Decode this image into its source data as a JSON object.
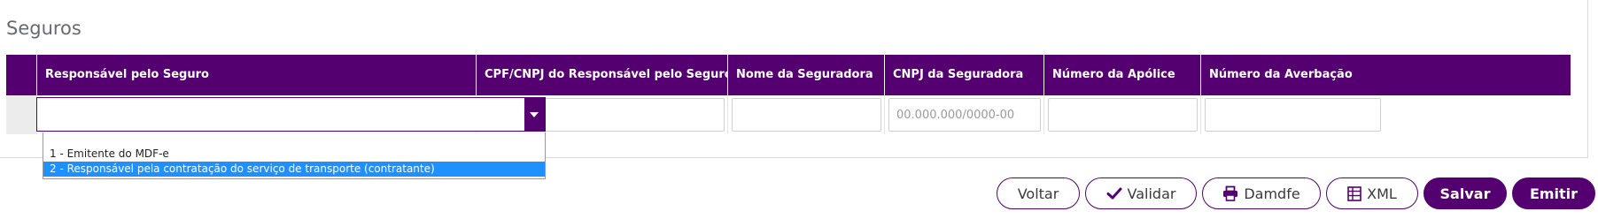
{
  "section": {
    "title": "Seguros"
  },
  "table": {
    "headers": [
      "Responsável pelo Seguro",
      "CPF/CNPJ do Responsável pelo Seguro",
      "Nome da Seguradora",
      "CNPJ da Seguradora",
      "Número da Apólice",
      "Número da Averbação"
    ],
    "row": {
      "cpf_cnpj_value": "",
      "seguradora_value": "",
      "cnpj_seguradora_placeholder": "00.000.000/0000-00",
      "apolice_value": "",
      "averbacao_value": ""
    }
  },
  "dropdown": {
    "selected": "",
    "options": [
      "1 - Emitente do MDF-e",
      "2 - Responsável pela contratação do serviço de transporte (contratante)"
    ],
    "highlighted_index": 1
  },
  "actions": {
    "voltar": "Voltar",
    "validar": "Validar",
    "damdfe": "Damdfe",
    "xml": "XML",
    "salvar": "Salvar",
    "emitir": "Emitir"
  },
  "colors": {
    "primary": "#540070",
    "highlight": "#1e90ff"
  },
  "icons": {
    "validar": "check-icon",
    "damdfe": "printer-icon",
    "xml": "table-icon"
  }
}
